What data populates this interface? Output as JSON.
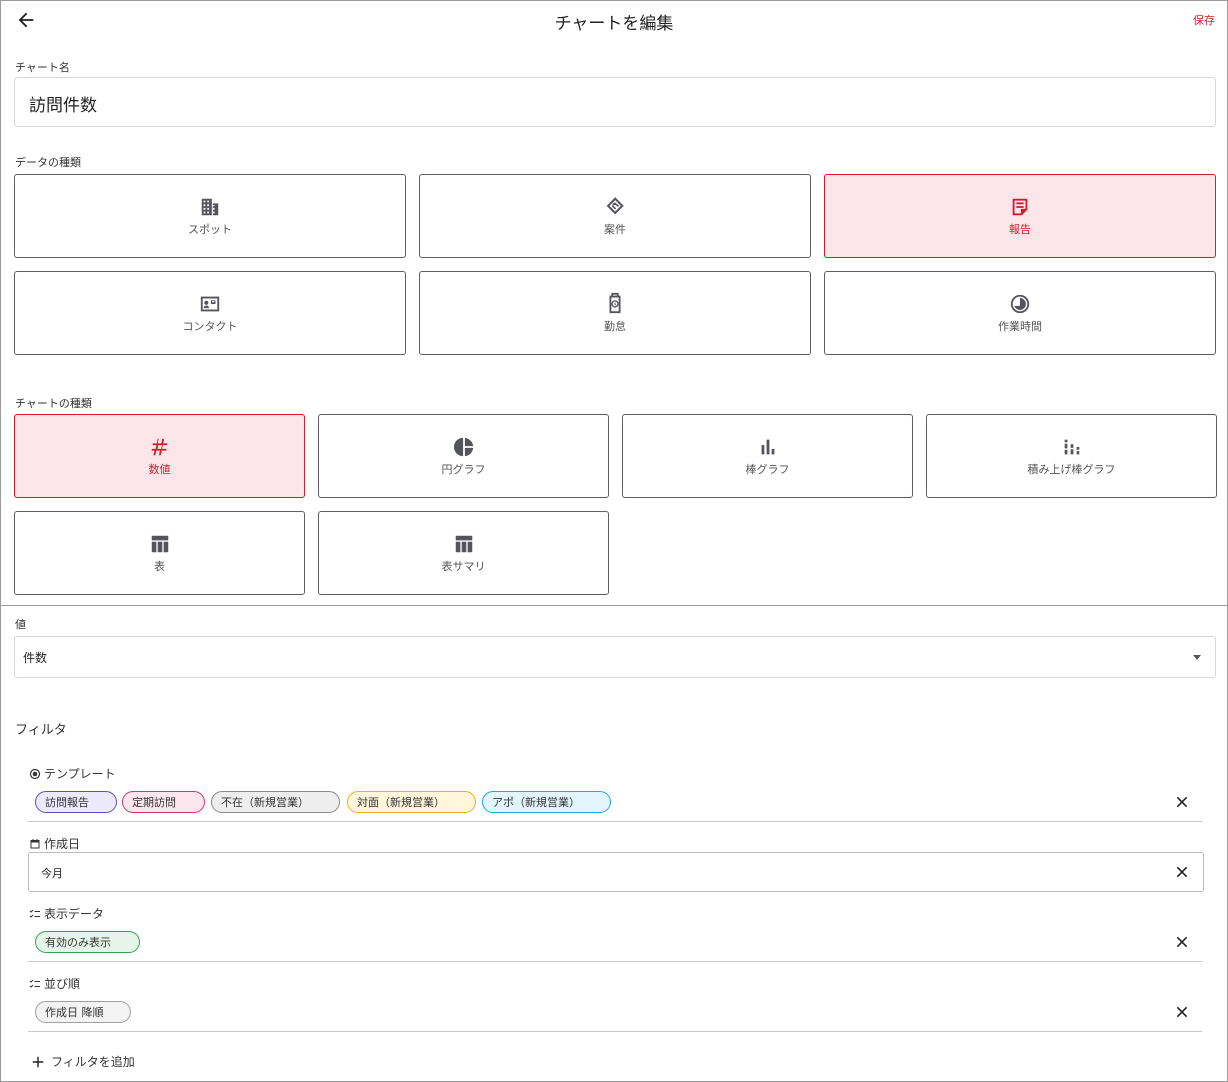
{
  "header": {
    "title": "チャートを編集",
    "save_label": "保存"
  },
  "chart_name": {
    "label": "チャート名",
    "value": "訪問件数"
  },
  "data_types": {
    "label": "データの種類",
    "items": [
      {
        "label": "スポット",
        "icon": "building-icon",
        "selected": false
      },
      {
        "label": "案件",
        "icon": "handshake-icon",
        "selected": false
      },
      {
        "label": "報告",
        "icon": "report-icon",
        "selected": true
      },
      {
        "label": "コンタクト",
        "icon": "contact-card-icon",
        "selected": false
      },
      {
        "label": "勤怠",
        "icon": "timeclock-icon",
        "selected": false
      },
      {
        "label": "作業時間",
        "icon": "clock-pie-icon",
        "selected": false
      }
    ]
  },
  "chart_types": {
    "label": "チャートの種類",
    "items": [
      {
        "label": "数値",
        "icon": "hash-icon",
        "selected": true
      },
      {
        "label": "円グラフ",
        "icon": "pie-chart-icon",
        "selected": false
      },
      {
        "label": "棒グラフ",
        "icon": "bar-chart-icon",
        "selected": false
      },
      {
        "label": "積み上げ棒グラフ",
        "icon": "stacked-bar-icon",
        "selected": false
      },
      {
        "label": "表",
        "icon": "table-icon",
        "selected": false
      },
      {
        "label": "表サマリ",
        "icon": "table-icon",
        "selected": false
      }
    ]
  },
  "value_field": {
    "label": "値",
    "value": "件数"
  },
  "filters": {
    "title": "フィルタ",
    "template": {
      "label": "テンプレート",
      "chips": [
        {
          "label": "訪問報告",
          "border": "#5b4fc7",
          "bg": "#ece9fb"
        },
        {
          "label": "定期訪問",
          "border": "#d8336b",
          "bg": "#fde6ee"
        },
        {
          "label": "不在（新規営業）",
          "border": "#8a8a8a",
          "bg": "#eeeeee"
        },
        {
          "label": "対面（新規営業）",
          "border": "#e8b417",
          "bg": "#fff6dc"
        },
        {
          "label": "アポ（新規営業）",
          "border": "#1ea7dd",
          "bg": "#e3f5fc"
        }
      ]
    },
    "created_date": {
      "label": "作成日",
      "value": "今月"
    },
    "display_data": {
      "label": "表示データ",
      "chip": {
        "label": "有効のみ表示",
        "border": "#2ea44f",
        "bg": "#e5f5e9"
      }
    },
    "sort_order": {
      "label": "並び順",
      "chip": {
        "label": "作成日 降順",
        "border": "#a0a0a0",
        "bg": "#f3f3f3"
      }
    },
    "add_label": "フィルタを追加"
  }
}
